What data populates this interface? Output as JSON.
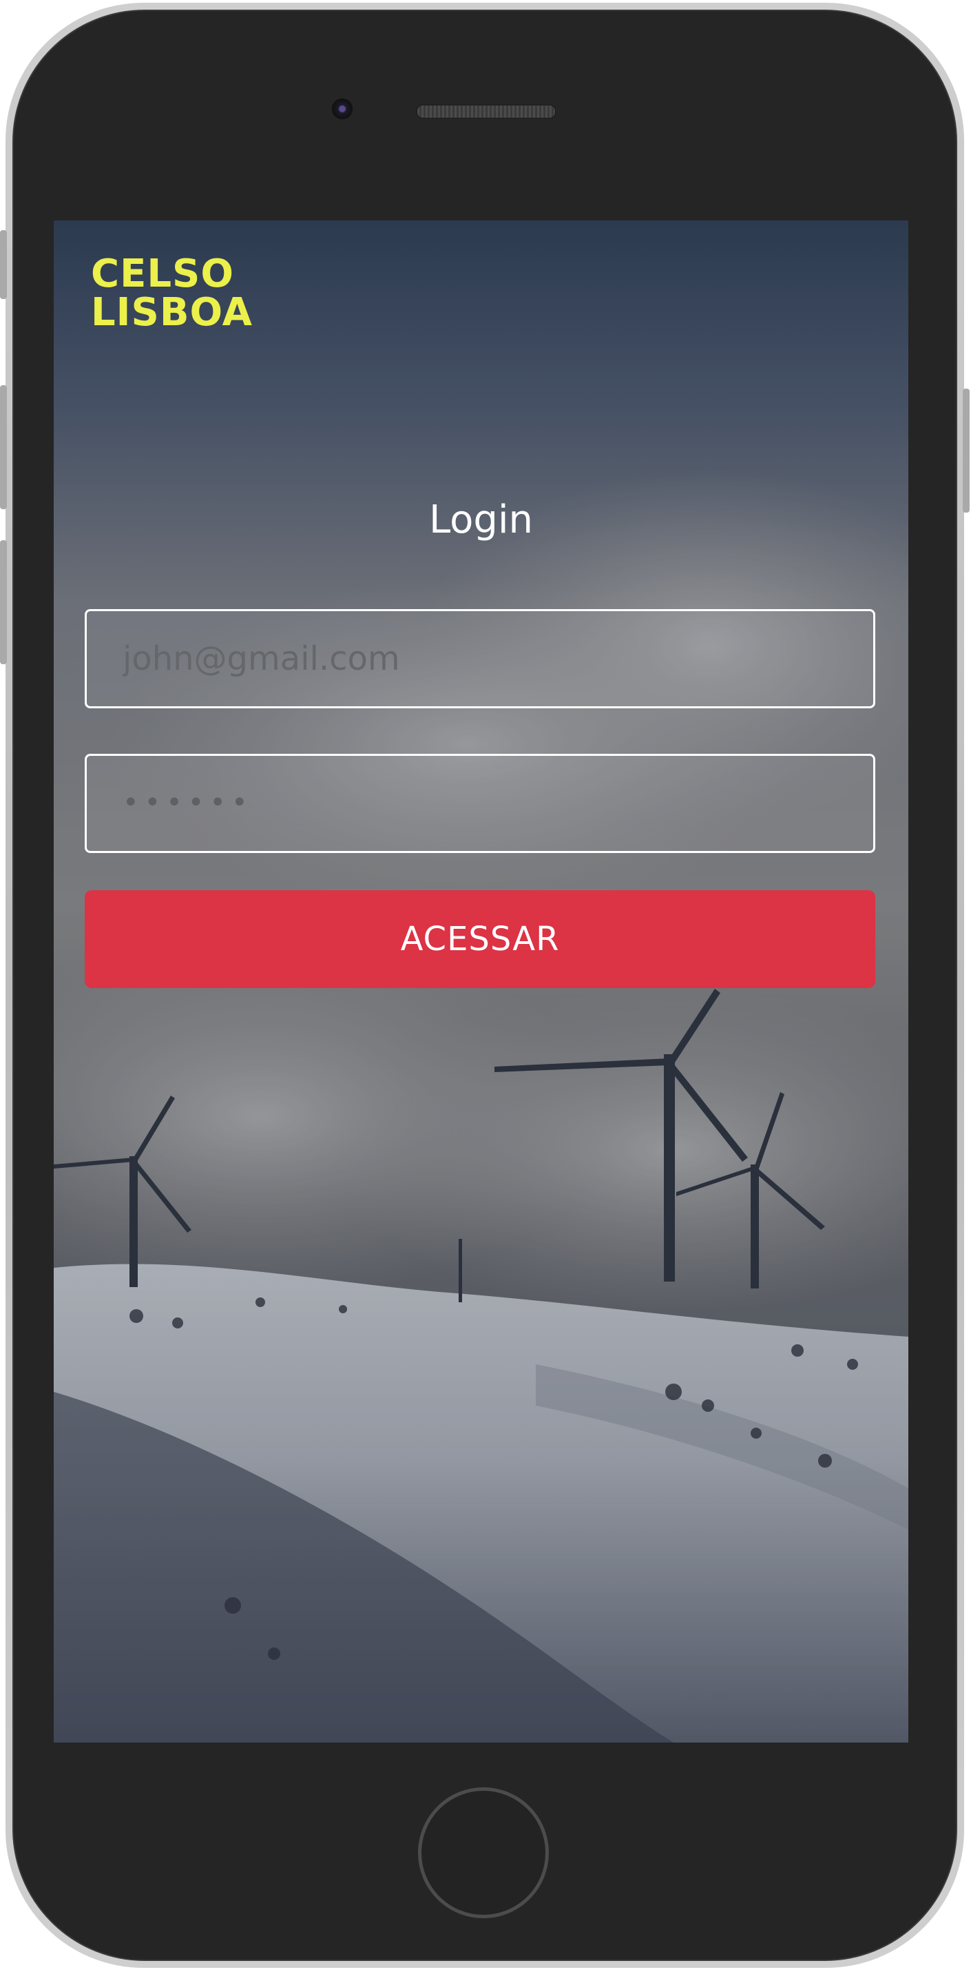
{
  "app": {
    "logo_line1": "CELSO",
    "logo_line2": "LISBOA"
  },
  "login": {
    "title": "Login",
    "email_placeholder": "john@gmail.com",
    "password_value": "••••••",
    "submit_label": "ACESSAR"
  },
  "colors": {
    "logo": "#ecf04a",
    "button": "#dc3345",
    "field_border": "#ffffff"
  },
  "icons": {
    "camera": "front-camera-icon",
    "speaker": "earpiece-speaker-icon",
    "home": "home-button-icon"
  }
}
